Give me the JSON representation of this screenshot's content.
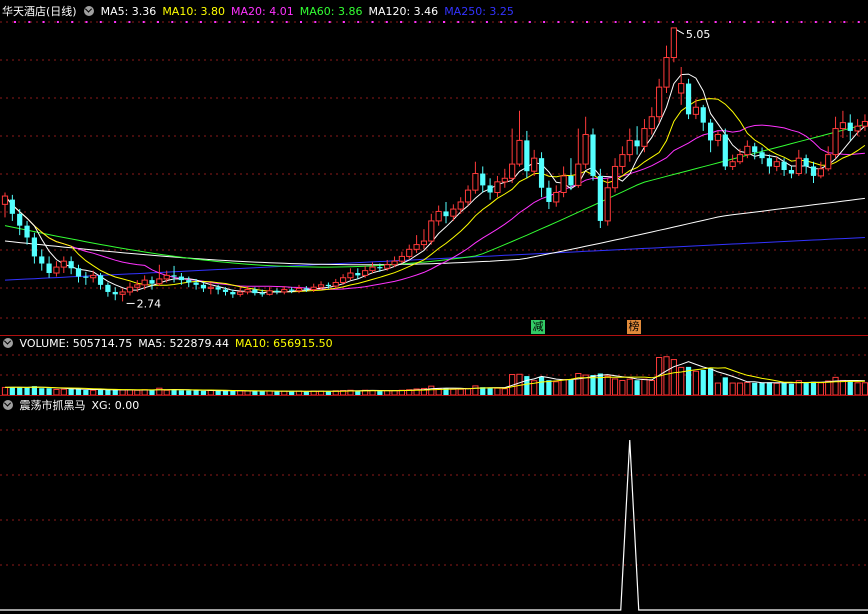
{
  "stock": {
    "title": "华天酒店(日线)"
  },
  "price_panel": {
    "ma_labels": [
      {
        "text": "MA5: 3.36",
        "color": "#ffffff"
      },
      {
        "text": "MA10: 3.80",
        "color": "#ffff00"
      },
      {
        "text": "MA20: 4.01",
        "color": "#ff33ff"
      },
      {
        "text": "MA60: 3.86",
        "color": "#33ff33"
      },
      {
        "text": "MA120: 3.46",
        "color": "#ffffff"
      },
      {
        "text": "MA250: 3.25",
        "color": "#3333ff"
      }
    ],
    "high_label": "5.05",
    "low_label": "2.74",
    "tags": [
      {
        "text": "减",
        "color": "#33cc66"
      },
      {
        "text": "榜",
        "color": "#e08a3a"
      }
    ]
  },
  "volume_panel": {
    "labels": [
      {
        "text": "VOLUME: 505714.75",
        "color": "#ffffff"
      },
      {
        "text": "MA5: 522879.44",
        "color": "#ffffff"
      },
      {
        "text": "MA10: 656915.50",
        "color": "#ffff00"
      }
    ]
  },
  "indicator_panel": {
    "labels": [
      {
        "text": "震荡市抓黑马",
        "color": "#ffffff"
      },
      {
        "text": "XG: 0.00",
        "color": "#ffffff"
      }
    ]
  },
  "colors": {
    "up": "#ff3a3a",
    "down": "#54ffff",
    "grid": "#8b1a1a",
    "ma5": "#ffffff",
    "ma10": "#ffff00",
    "ma20": "#ff33ff",
    "ma60": "#33ff33",
    "ma120": "#ffffff",
    "ma250": "#3333ff"
  },
  "chart_data": [
    {
      "type": "candlestick",
      "title": "华天酒店(日线)",
      "candles": [
        [
          3.56,
          3.63,
          3.66,
          3.45
        ],
        [
          3.6,
          3.48,
          3.64,
          3.42
        ],
        [
          3.48,
          3.38,
          3.52,
          3.3
        ],
        [
          3.38,
          3.28,
          3.42,
          3.22
        ],
        [
          3.28,
          3.12,
          3.32,
          3.06
        ],
        [
          3.12,
          3.06,
          3.18,
          3.0
        ],
        [
          3.06,
          2.98,
          3.12,
          2.94
        ],
        [
          2.98,
          3.03,
          3.08,
          2.95
        ],
        [
          3.03,
          3.08,
          3.12,
          2.98
        ],
        [
          3.08,
          3.02,
          3.12,
          2.97
        ],
        [
          3.02,
          2.95,
          3.05,
          2.9
        ],
        [
          2.95,
          2.94,
          2.99,
          2.88
        ],
        [
          2.94,
          2.96,
          3.0,
          2.9
        ],
        [
          2.96,
          2.88,
          2.98,
          2.84
        ],
        [
          2.88,
          2.82,
          2.9,
          2.78
        ],
        [
          2.82,
          2.8,
          2.86,
          2.75
        ],
        [
          2.8,
          2.82,
          2.85,
          2.74
        ],
        [
          2.82,
          2.86,
          2.9,
          2.79
        ],
        [
          2.86,
          2.88,
          2.92,
          2.82
        ],
        [
          2.88,
          2.92,
          2.96,
          2.84
        ],
        [
          2.92,
          2.89,
          2.95,
          2.84
        ],
        [
          2.89,
          2.93,
          3.05,
          2.87
        ],
        [
          2.93,
          2.96,
          3.0,
          2.9
        ],
        [
          2.96,
          2.95,
          3.04,
          2.9
        ],
        [
          2.95,
          2.92,
          2.98,
          2.88
        ],
        [
          2.92,
          2.9,
          2.95,
          2.86
        ],
        [
          2.9,
          2.88,
          2.93,
          2.84
        ],
        [
          2.88,
          2.85,
          2.9,
          2.82
        ],
        [
          2.85,
          2.86,
          2.9,
          2.8
        ],
        [
          2.86,
          2.84,
          2.88,
          2.8
        ],
        [
          2.84,
          2.82,
          2.86,
          2.79
        ],
        [
          2.82,
          2.8,
          2.84,
          2.77
        ],
        [
          2.8,
          2.82,
          2.86,
          2.78
        ],
        [
          2.82,
          2.84,
          2.87,
          2.8
        ],
        [
          2.84,
          2.81,
          2.86,
          2.79
        ],
        [
          2.81,
          2.8,
          2.84,
          2.78
        ],
        [
          2.8,
          2.83,
          2.86,
          2.79
        ],
        [
          2.83,
          2.82,
          2.85,
          2.8
        ],
        [
          2.82,
          2.84,
          2.87,
          2.8
        ],
        [
          2.84,
          2.83,
          2.86,
          2.81
        ],
        [
          2.83,
          2.85,
          2.88,
          2.81
        ],
        [
          2.85,
          2.84,
          2.87,
          2.82
        ],
        [
          2.84,
          2.86,
          2.89,
          2.82
        ],
        [
          2.86,
          2.88,
          2.91,
          2.84
        ],
        [
          2.88,
          2.87,
          2.9,
          2.85
        ],
        [
          2.87,
          2.9,
          2.93,
          2.85
        ],
        [
          2.9,
          2.94,
          2.97,
          2.88
        ],
        [
          2.94,
          2.98,
          3.02,
          2.92
        ],
        [
          2.98,
          2.96,
          3.02,
          2.93
        ],
        [
          2.96,
          3.0,
          3.04,
          2.94
        ],
        [
          3.0,
          3.03,
          3.07,
          2.98
        ],
        [
          3.03,
          3.02,
          3.06,
          2.99
        ],
        [
          3.02,
          3.05,
          3.09,
          3.0
        ],
        [
          3.05,
          3.08,
          3.12,
          3.03
        ],
        [
          3.08,
          3.12,
          3.16,
          3.06
        ],
        [
          3.12,
          3.18,
          3.22,
          3.1
        ],
        [
          3.18,
          3.22,
          3.3,
          3.15
        ],
        [
          3.22,
          3.25,
          3.35,
          3.18
        ],
        [
          3.25,
          3.42,
          3.48,
          3.22
        ],
        [
          3.42,
          3.5,
          3.55,
          3.38
        ],
        [
          3.5,
          3.46,
          3.58,
          3.4
        ],
        [
          3.46,
          3.52,
          3.56,
          3.42
        ],
        [
          3.52,
          3.58,
          3.62,
          3.48
        ],
        [
          3.58,
          3.68,
          3.72,
          3.55
        ],
        [
          3.68,
          3.82,
          3.92,
          3.65
        ],
        [
          3.82,
          3.72,
          3.88,
          3.66
        ],
        [
          3.72,
          3.66,
          3.78,
          3.6
        ],
        [
          3.66,
          3.75,
          3.8,
          3.62
        ],
        [
          3.75,
          3.78,
          3.86,
          3.7
        ],
        [
          3.78,
          3.9,
          4.2,
          3.74
        ],
        [
          3.9,
          4.1,
          4.35,
          3.88
        ],
        [
          4.1,
          3.84,
          4.18,
          3.78
        ],
        [
          3.84,
          3.95,
          4.02,
          3.8
        ],
        [
          3.95,
          3.7,
          4.0,
          3.62
        ],
        [
          3.7,
          3.58,
          3.76,
          3.52
        ],
        [
          3.58,
          3.66,
          3.72,
          3.54
        ],
        [
          3.66,
          3.8,
          3.88,
          3.62
        ],
        [
          3.8,
          3.72,
          3.95,
          3.68
        ],
        [
          3.72,
          3.9,
          4.2,
          3.7
        ],
        [
          3.9,
          4.15,
          4.3,
          3.86
        ],
        [
          4.15,
          3.8,
          4.2,
          3.76
        ],
        [
          3.8,
          3.42,
          3.86,
          3.36
        ],
        [
          3.42,
          3.7,
          3.78,
          3.38
        ],
        [
          3.7,
          3.88,
          3.95,
          3.66
        ],
        [
          3.88,
          3.98,
          4.05,
          3.82
        ],
        [
          3.98,
          4.1,
          4.2,
          3.92
        ],
        [
          4.1,
          4.05,
          4.22,
          3.98
        ],
        [
          4.05,
          4.2,
          4.28,
          4.0
        ],
        [
          4.2,
          4.3,
          4.38,
          4.15
        ],
        [
          4.3,
          4.55,
          4.62,
          4.25
        ],
        [
          4.55,
          4.8,
          4.9,
          4.5
        ],
        [
          4.8,
          5.05,
          5.05,
          4.76
        ],
        [
          4.5,
          4.58,
          4.72,
          4.4
        ],
        [
          4.58,
          4.32,
          4.62,
          4.28
        ],
        [
          4.32,
          4.38,
          4.45,
          4.28
        ],
        [
          4.38,
          4.25,
          4.4,
          4.18
        ],
        [
          4.25,
          4.1,
          4.28,
          4.0
        ],
        [
          4.1,
          4.15,
          4.18,
          4.05
        ],
        [
          4.15,
          3.88,
          4.2,
          3.85
        ],
        [
          3.88,
          3.92,
          3.98,
          3.85
        ],
        [
          3.92,
          3.98,
          4.03,
          3.9
        ],
        [
          3.98,
          4.05,
          4.1,
          3.95
        ],
        [
          4.05,
          4.0,
          4.08,
          3.94
        ],
        [
          4.0,
          3.95,
          4.04,
          3.9
        ],
        [
          3.95,
          3.88,
          3.98,
          3.82
        ],
        [
          3.88,
          3.92,
          3.96,
          3.84
        ],
        [
          3.92,
          3.85,
          3.95,
          3.8
        ],
        [
          3.85,
          3.82,
          3.88,
          3.78
        ],
        [
          3.82,
          3.95,
          4.02,
          3.8
        ],
        [
          3.95,
          3.88,
          3.98,
          3.82
        ],
        [
          3.88,
          3.8,
          3.92,
          3.74
        ],
        [
          3.8,
          3.86,
          3.92,
          3.78
        ],
        [
          3.86,
          3.98,
          4.05,
          3.84
        ],
        [
          3.98,
          4.2,
          4.3,
          3.95
        ],
        [
          4.2,
          4.25,
          4.35,
          4.12
        ],
        [
          4.25,
          4.18,
          4.32,
          4.1
        ],
        [
          4.18,
          4.22,
          4.28,
          4.14
        ],
        [
          4.22,
          4.26,
          4.32,
          4.18
        ]
      ],
      "ma": {
        "ma5": {
          "name": "MA5",
          "last": 3.36
        },
        "ma10": {
          "name": "MA10",
          "last": 3.8
        },
        "ma20": {
          "name": "MA20",
          "last": 4.01
        },
        "ma60": {
          "name": "MA60",
          "last": 3.86
        },
        "ma120": {
          "name": "MA120",
          "last": 3.46
        },
        "ma250": {
          "name": "MA250",
          "last": 3.25
        }
      },
      "high": 5.05,
      "low": 2.74
    },
    {
      "type": "bar",
      "title": "VOLUME",
      "series": [
        {
          "name": "VOLUME",
          "last": 505714.75
        }
      ],
      "ma5_last": 522879.44,
      "ma10_last": 656915.5
    },
    {
      "type": "line",
      "title": "震荡市抓黑马",
      "series": [
        {
          "name": "XG",
          "last": 0.0,
          "spike_at_candle": 85,
          "spike_value": 1
        }
      ]
    }
  ]
}
